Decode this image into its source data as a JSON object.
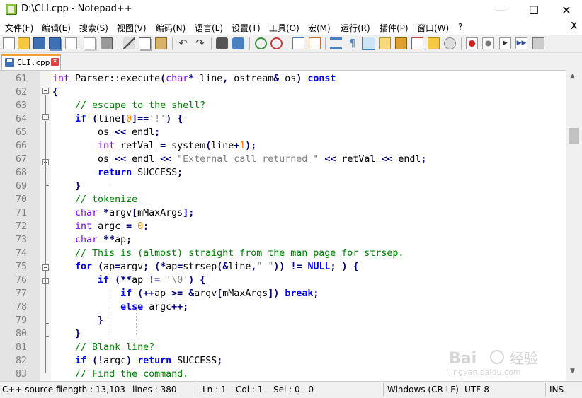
{
  "window": {
    "title": "D:\\CLI.cpp - Notepad++",
    "minimize": "—",
    "maximize": "☐",
    "close": "✕"
  },
  "menu": {
    "items": [
      "文件(F)",
      "编辑(E)",
      "搜索(S)",
      "视图(V)",
      "编码(N)",
      "语言(L)",
      "设置(T)",
      "工具(O)",
      "宏(M)",
      "运行(R)",
      "插件(P)",
      "窗口(W)",
      "?"
    ],
    "close_doc": "X"
  },
  "toolbar": {
    "icons": [
      "new-file-icon",
      "open-file-icon",
      "save-icon",
      "save-all-icon",
      "close-icon",
      "close-all-icon",
      "print-icon",
      "cut-icon",
      "copy-icon",
      "paste-icon",
      "undo-icon",
      "redo-icon",
      "find-icon",
      "replace-icon",
      "zoom-in-icon",
      "zoom-out-icon",
      "sync-vertical-icon",
      "sync-horizontal-icon",
      "word-wrap-icon",
      "show-all-chars-icon",
      "indent-guide-icon",
      "udl-icon",
      "doc-map-icon",
      "function-list-icon",
      "folder-workspace-icon",
      "monitoring-icon",
      "record-macro-icon",
      "stop-macro-icon",
      "play-macro-icon",
      "run-macro-multiple-icon",
      "save-macro-icon"
    ]
  },
  "tab": {
    "label": "CLI.cpp",
    "close": "✕"
  },
  "editor": {
    "lines": [
      {
        "n": "61",
        "code": "int Parser::execute(char* line, ostream& os) const"
      },
      {
        "n": "62",
        "code": "{"
      },
      {
        "n": "63",
        "code": "    // escape to the shell?"
      },
      {
        "n": "64",
        "code": "    if (line[0]=='!') {"
      },
      {
        "n": "65",
        "code": "        os << endl;"
      },
      {
        "n": "66",
        "code": "        int retVal = system(line+1);"
      },
      {
        "n": "67",
        "code": "        os << endl << \"External call returned \" << retVal << endl;"
      },
      {
        "n": "68",
        "code": "        return SUCCESS;"
      },
      {
        "n": "69",
        "code": "    }"
      },
      {
        "n": "70",
        "code": "    // tokenize"
      },
      {
        "n": "71",
        "code": "    char *argv[mMaxArgs];"
      },
      {
        "n": "72",
        "code": "    int argc = 0;"
      },
      {
        "n": "73",
        "code": "    char **ap;"
      },
      {
        "n": "74",
        "code": "    // This is (almost) straight from the man page for strsep."
      },
      {
        "n": "75",
        "code": "    for (ap=argv; (*ap=strsep(&line,\" \")) != NULL; ) {"
      },
      {
        "n": "76",
        "code": "        if (**ap != '\\0') {"
      },
      {
        "n": "77",
        "code": "            if (++ap >= &argv[mMaxArgs]) break;"
      },
      {
        "n": "78",
        "code": "            else argc++;"
      },
      {
        "n": "79",
        "code": "        }"
      },
      {
        "n": "80",
        "code": "    }"
      },
      {
        "n": "81",
        "code": "    // Blank line?"
      },
      {
        "n": "82",
        "code": "    if (!argc) return SUCCESS;"
      },
      {
        "n": "83",
        "code": "    // Find the command."
      }
    ]
  },
  "status": {
    "file_type": "C++ source fi",
    "length": "length : 13,103",
    "lines": "lines : 380",
    "ln": "Ln : 1",
    "col": "Col : 1",
    "sel": "Sel : 0 | 0",
    "eol": "Windows (CR LF)",
    "encoding": "UTF-8",
    "mode": "INS"
  },
  "watermark": {
    "brand": "Bai",
    "brand2": "经验",
    "url": "jingyan.baidu.com"
  },
  "colors": {
    "keyword": "#0000ff",
    "type": "#8000ff",
    "comment": "#008000",
    "string": "#808080",
    "number": "#ff8000",
    "operator": "#000080"
  }
}
